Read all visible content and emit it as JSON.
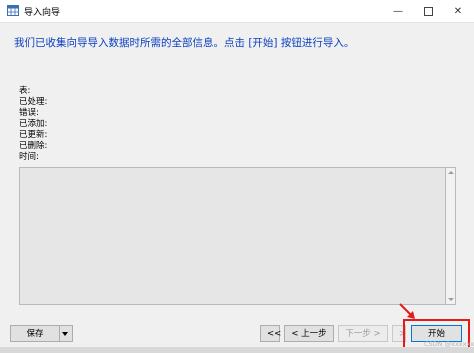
{
  "window": {
    "title": "导入向导",
    "app_icon": "table-grid-icon",
    "controls": {
      "minimize": "—",
      "close": "✕"
    }
  },
  "instruction": "我们已收集向导导入数据时所需的全部信息。点击 [开始] 按钮进行导入。",
  "stats": [
    {
      "label": "表:"
    },
    {
      "label": "已处理:"
    },
    {
      "label": "错误:"
    },
    {
      "label": "已添加:"
    },
    {
      "label": "已更新:"
    },
    {
      "label": "已删除:"
    },
    {
      "label": "时间:"
    }
  ],
  "log_area": {
    "text": ""
  },
  "buttons": {
    "save": "保存",
    "first": "<<",
    "back": "< 上一步",
    "next": "下一步 >",
    "last": ">",
    "start": "开始"
  },
  "annotation": {
    "highlight_color": "#e21b1b"
  },
  "colors": {
    "instruction_text": "#0a3fbf",
    "window_bg": "#f0f0f0"
  },
  "watermark": "CSDN @xxxxxx"
}
